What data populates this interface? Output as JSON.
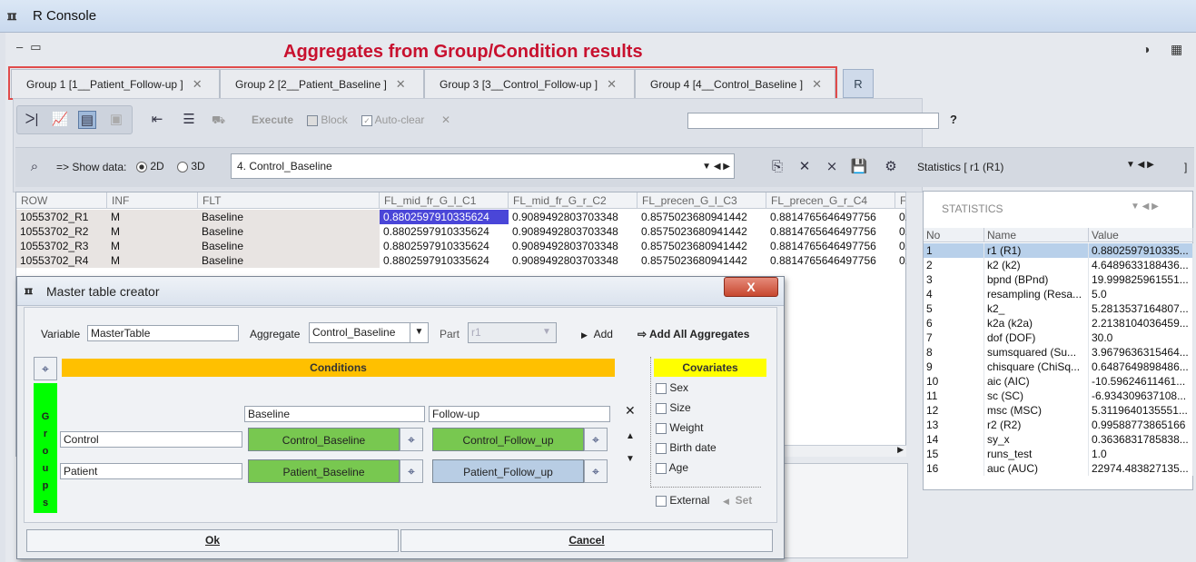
{
  "window": {
    "title": "R Console",
    "logo": "ℼ"
  },
  "banner": "Aggregates from Group/Condition results",
  "tabs": [
    {
      "label": "Group 1 [1__Patient_Follow-up ]"
    },
    {
      "label": "Group 2 [2__Patient_Baseline ]"
    },
    {
      "label": "Group 3 [3__Control_Follow-up ]"
    },
    {
      "label": "Group 4 [4__Control_Baseline ]"
    }
  ],
  "tab_r": "R",
  "toolbar": {
    "execute": "Execute",
    "block": "Block",
    "autoclear": "Auto-clear",
    "help": "?"
  },
  "showdata": {
    "label": "=> Show data:",
    "opt2d": "2D",
    "opt3d": "3D",
    "selected": "4. Control_Baseline",
    "stats_label": "Statistics [",
    "stats_value": "r1 (R1)",
    "stats_end": "]"
  },
  "grid": {
    "headers": [
      "ROW",
      "INF",
      "FLT",
      "FL_mid_fr_G_l_C1",
      "FL_mid_fr_G_r_C2",
      "FL_precen_G_l_C3",
      "FL_precen_G_r_C4",
      "F"
    ],
    "rows": [
      [
        "10553702_R1",
        "M",
        "Baseline",
        "0.8802597910335624",
        "0.9089492803703348",
        "0.8575023680941442",
        "0.8814765646497756",
        "0."
      ],
      [
        "10553702_R2",
        "M",
        "Baseline",
        "0.8802597910335624",
        "0.9089492803703348",
        "0.8575023680941442",
        "0.8814765646497756",
        "0."
      ],
      [
        "10553702_R3",
        "M",
        "Baseline",
        "0.8802597910335624",
        "0.9089492803703348",
        "0.8575023680941442",
        "0.8814765646497756",
        "0."
      ],
      [
        "10553702_R4",
        "M",
        "Baseline",
        "0.8802597910335624",
        "0.9089492803703348",
        "0.8575023680941442",
        "0.8814765646497756",
        "0."
      ]
    ]
  },
  "stats": {
    "title": "STATISTICS",
    "headers": [
      "No",
      "Name",
      "Value"
    ],
    "rows": [
      [
        "1",
        "r1 (R1)",
        "0.8802597910335..."
      ],
      [
        "2",
        "k2 (k2)",
        "4.6489633188436..."
      ],
      [
        "3",
        "bpnd (BPnd)",
        "19.999825961551..."
      ],
      [
        "4",
        "resampling (Resa...",
        "5.0"
      ],
      [
        "5",
        "k2_",
        "5.2813537164807..."
      ],
      [
        "6",
        "k2a (k2a)",
        "2.2138104036459..."
      ],
      [
        "7",
        "dof (DOF)",
        "30.0"
      ],
      [
        "8",
        "sumsquared (Su...",
        "3.9679636315464..."
      ],
      [
        "9",
        "chisquare (ChiSq...",
        "0.6487649898486..."
      ],
      [
        "10",
        "aic (AIC)",
        "-10.59624611461..."
      ],
      [
        "11",
        "sc (SC)",
        "-6.934309637108..."
      ],
      [
        "12",
        "msc (MSC)",
        "5.3119640135551..."
      ],
      [
        "13",
        "r2 (R2)",
        "0.99588773865166"
      ],
      [
        "14",
        "sy_x",
        "0.3636831785838..."
      ],
      [
        "15",
        "runs_test",
        "1.0"
      ],
      [
        "16",
        "auc (AUC)",
        "22974.483827135..."
      ]
    ]
  },
  "dialog": {
    "title": "Master table creator",
    "close": "X",
    "variable_label": "Variable",
    "variable_value": "MasterTable",
    "aggregate_label": "Aggregate",
    "aggregate_value": "Control_Baseline",
    "part_label": "Part",
    "part_value": "r1",
    "add": "Add",
    "add_all": "Add All Aggregates",
    "conditions": "Conditions",
    "covariates": "Covariates",
    "groups_letters": [
      "G",
      "r",
      "o",
      "u",
      "p",
      "s"
    ],
    "cond_cols": [
      "Baseline",
      "Follow-up"
    ],
    "groups": [
      {
        "name": "Control",
        "cells": [
          "Control_Baseline",
          "Control_Follow_up"
        ]
      },
      {
        "name": "Patient",
        "cells": [
          "Patient_Baseline",
          "Patient_Follow_up"
        ]
      }
    ],
    "covariate_items": [
      "Sex",
      "Size",
      "Weight",
      "Birth date",
      "Age"
    ],
    "external": "External",
    "set": "Set",
    "ok": "Ok",
    "cancel": "Cancel"
  },
  "colors": {
    "banner": "#c8102e",
    "conditions_bar": "#ffc000",
    "covariates_bar": "#ffff00",
    "groups_bar": "#00ff00",
    "assigned_cell": "#78c850",
    "unassigned_cell": "#b8cde4",
    "selected_value": "#4a46d8"
  }
}
